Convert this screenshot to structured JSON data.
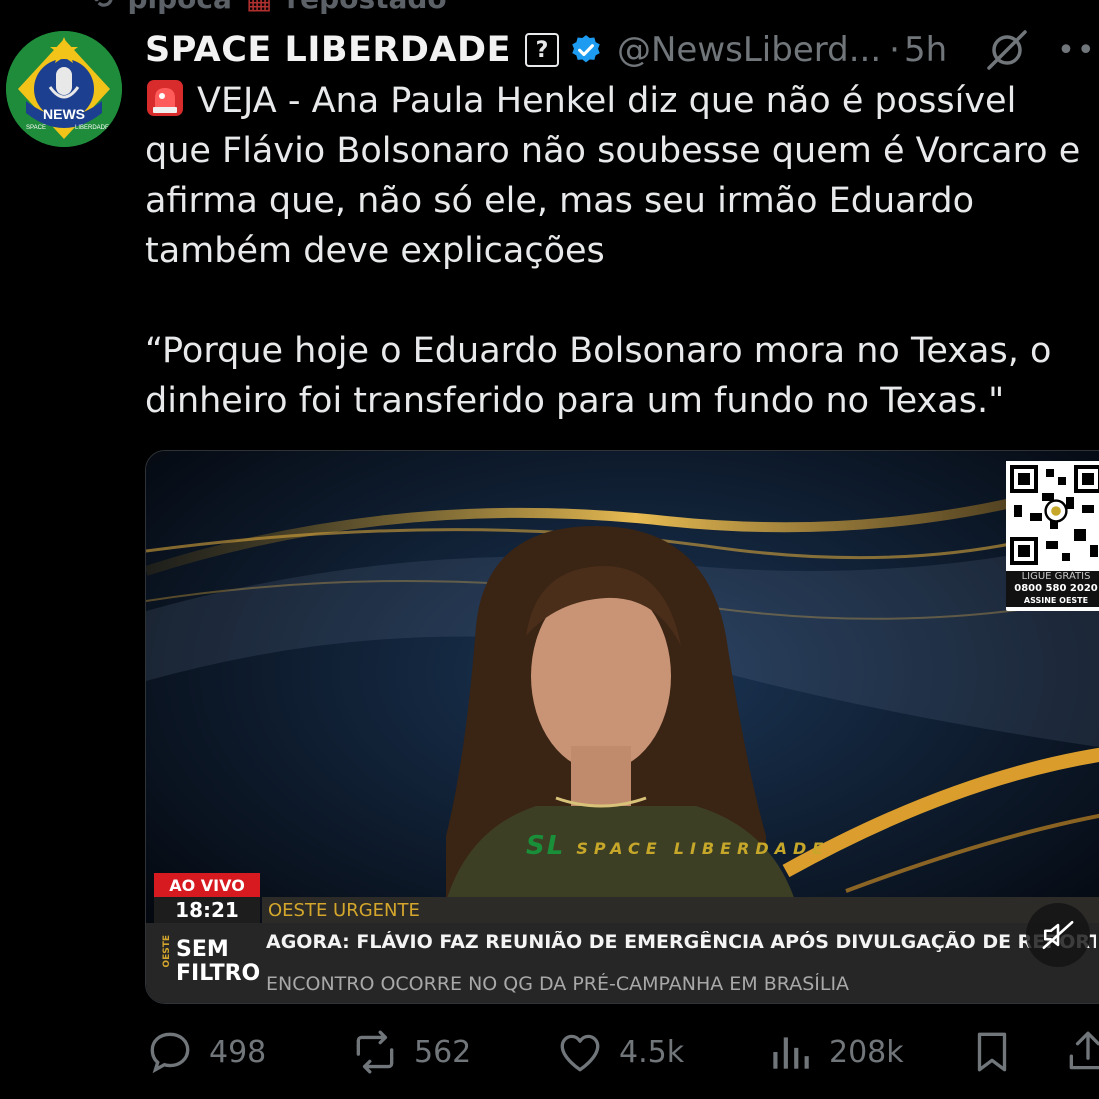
{
  "repost_context": {
    "user": "pipoca",
    "action": "repostado"
  },
  "author": {
    "name": "SPACE LIBERDADE",
    "unknown_badge": "?",
    "handle": "@NewsLiberd...",
    "separator": "·",
    "time": "5h",
    "avatar_text": "NEWS",
    "avatar_sub_left": "SPACE",
    "avatar_sub_right": "LIBERDADE"
  },
  "tweet": {
    "line1": "VEJA - Ana Paula Henkel diz que não é possível",
    "line2": "que Flávio Bolsonaro não soubesse quem é Vorcaro e",
    "line3": "afirma que, não só ele, mas seu irmão Eduardo",
    "line4": "também deve explicações",
    "quote1": "“Porque hoje o Eduardo Bolsonaro mora no Texas, o",
    "quote2": "dinheiro foi transferido para um fundo no Texas.\""
  },
  "video": {
    "qr_line1": "LIGUE GRÁTIS",
    "qr_line2": "0800 580 2020",
    "qr_line3": "ASSINE OESTE",
    "watermark_main": "SL",
    "watermark_top": "SPACE",
    "watermark_bottom": "LIBERDADE",
    "live_label": "AO VIVO",
    "clock": "18:21",
    "section": "OESTE URGENTE",
    "brand_side": "OESTE",
    "brand_line1": "SEM",
    "brand_line2": "FILTRO",
    "headline": "AGORA: FLÁVIO FAZ REUNIÃO DE EMERGÊNCIA APÓS DIVULGAÇÃO DE REPORTAGEM",
    "subline": "ENCONTRO OCORRE NO QG DA PRÉ-CAMPANHA EM BRASÍLIA"
  },
  "actions": {
    "replies": "498",
    "reposts": "562",
    "likes": "4.5k",
    "views": "208k"
  },
  "colors": {
    "background": "#000000",
    "verified": "#1d9bf0",
    "muted_text": "#71767b",
    "live_red": "#d71920",
    "gold": "#d4a72c"
  }
}
